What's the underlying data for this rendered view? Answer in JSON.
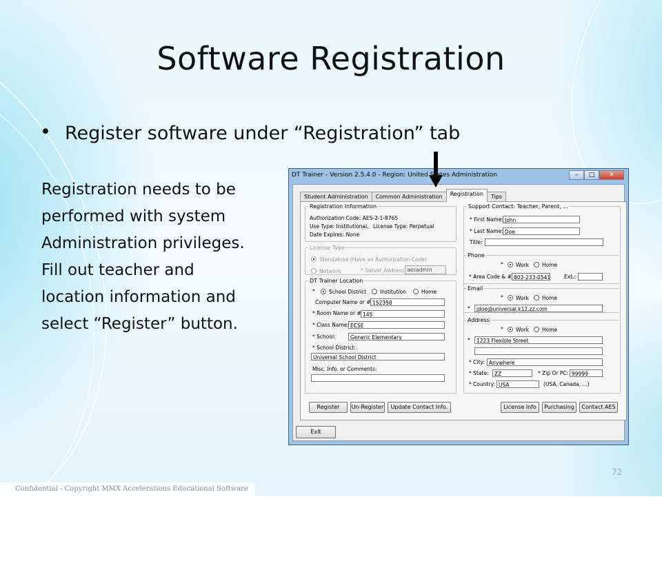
{
  "slide": {
    "title": "Software Registration",
    "bullet": "Register software under “Registration” tab",
    "body_lines": [
      "Registration needs to be",
      "performed with system",
      "Administration privileges.",
      "Fill out teacher and",
      "location information and",
      "select “Register” button."
    ],
    "footer": "Confidential - Copyright MMX Accelerations Educational Software",
    "page_number": "72"
  },
  "window": {
    "title": "DT Trainer - Version 2.5.4.0 - Region: United States Administration",
    "buttons": {
      "minimize": "–",
      "maximize": "□",
      "close": "✕"
    },
    "tabs": [
      "Student Administration",
      "Common Administration",
      "Registration",
      "Tips"
    ],
    "active_tab": "Registration",
    "registration_info": {
      "legend": "Registration Information",
      "auth_code": "Authorization Code: AES-2-1-8765",
      "use_type": "Use Type: Institutional,",
      "license_type": "License Type: Perpetual",
      "date_expires": "Date Expires: None"
    },
    "license_type": {
      "legend": "License Type",
      "standalone_label": "Standalone (Have an Authorization Code)",
      "network_label": "Network",
      "server_label": "* Server Address:",
      "server_value": "aesadmin",
      "selected": "Standalone"
    },
    "location": {
      "legend": "DT Trainer Location",
      "star": "*",
      "options": [
        "School District",
        "Institution",
        "Home"
      ],
      "selected": "School District",
      "computer_label": "Computer Name or #:",
      "computer_value": "152358",
      "room_label": "* Room Name or #:",
      "room_value": "145",
      "class_label": "* Class Name:",
      "class_value": "ECSE",
      "school_label": "* School:",
      "school_value": "Generic Elementary",
      "district_label": "* School District:",
      "district_value": "Universal School District",
      "misc_label": "Misc. Info. or Comments:",
      "misc_value": ""
    },
    "support": {
      "legend": "Support Contact: Teacher, Parent, ...",
      "first_label": "* First Name:",
      "first_value": "John",
      "last_label": "* Last Name:",
      "last_value": "Doe",
      "title_label": "Title:",
      "title_value": "",
      "phone_legend": "Phone",
      "email_legend": "Email",
      "address_legend": "Address",
      "star": "*",
      "work_label": "Work",
      "home_label": "Home",
      "area_label": "* Area Code & #:",
      "area_value": "803-233-0541",
      "ext_label": "Ext.:",
      "ext_value": "",
      "email_value": "jdoe@universal.k12.zz.com",
      "address1_value": "1223 Flexible Street",
      "address2_value": "",
      "city_label": "* City:",
      "city_value": "Anywhere",
      "state_label": "* State:",
      "state_value": "ZZ",
      "zip_label": "* Zip Or PC:",
      "zip_value": "99999",
      "country_label": "* Country:",
      "country_value": "USA",
      "country_hint": "(USA, Canada, ...)"
    },
    "buttons_row": {
      "register": "Register",
      "unregister": "Un-Register",
      "update": "Update Contact Info.",
      "license": "License Info",
      "purchasing": "Purchasing",
      "contact": "Contact AES"
    },
    "exit": "Exit"
  }
}
